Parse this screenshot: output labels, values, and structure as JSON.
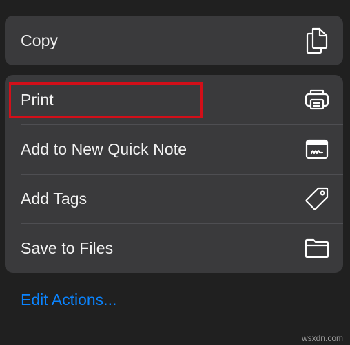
{
  "menu": {
    "top_group": [
      {
        "label": "Copy",
        "icon": "copy-icon"
      }
    ],
    "main_group": [
      {
        "label": "Print",
        "icon": "printer-icon"
      },
      {
        "label": "Add to New Quick Note",
        "icon": "quick-note-icon"
      },
      {
        "label": "Add Tags",
        "icon": "tag-icon"
      },
      {
        "label": "Save to Files",
        "icon": "folder-icon"
      }
    ]
  },
  "edit_actions_label": "Edit Actions...",
  "highlight": {
    "target": "Print",
    "color": "#d20f19"
  },
  "watermark": "wsxdn.com",
  "colors": {
    "background": "#202020",
    "panel": "#3a3a3c",
    "text": "#f2f2f2",
    "link": "#0a84ff"
  }
}
